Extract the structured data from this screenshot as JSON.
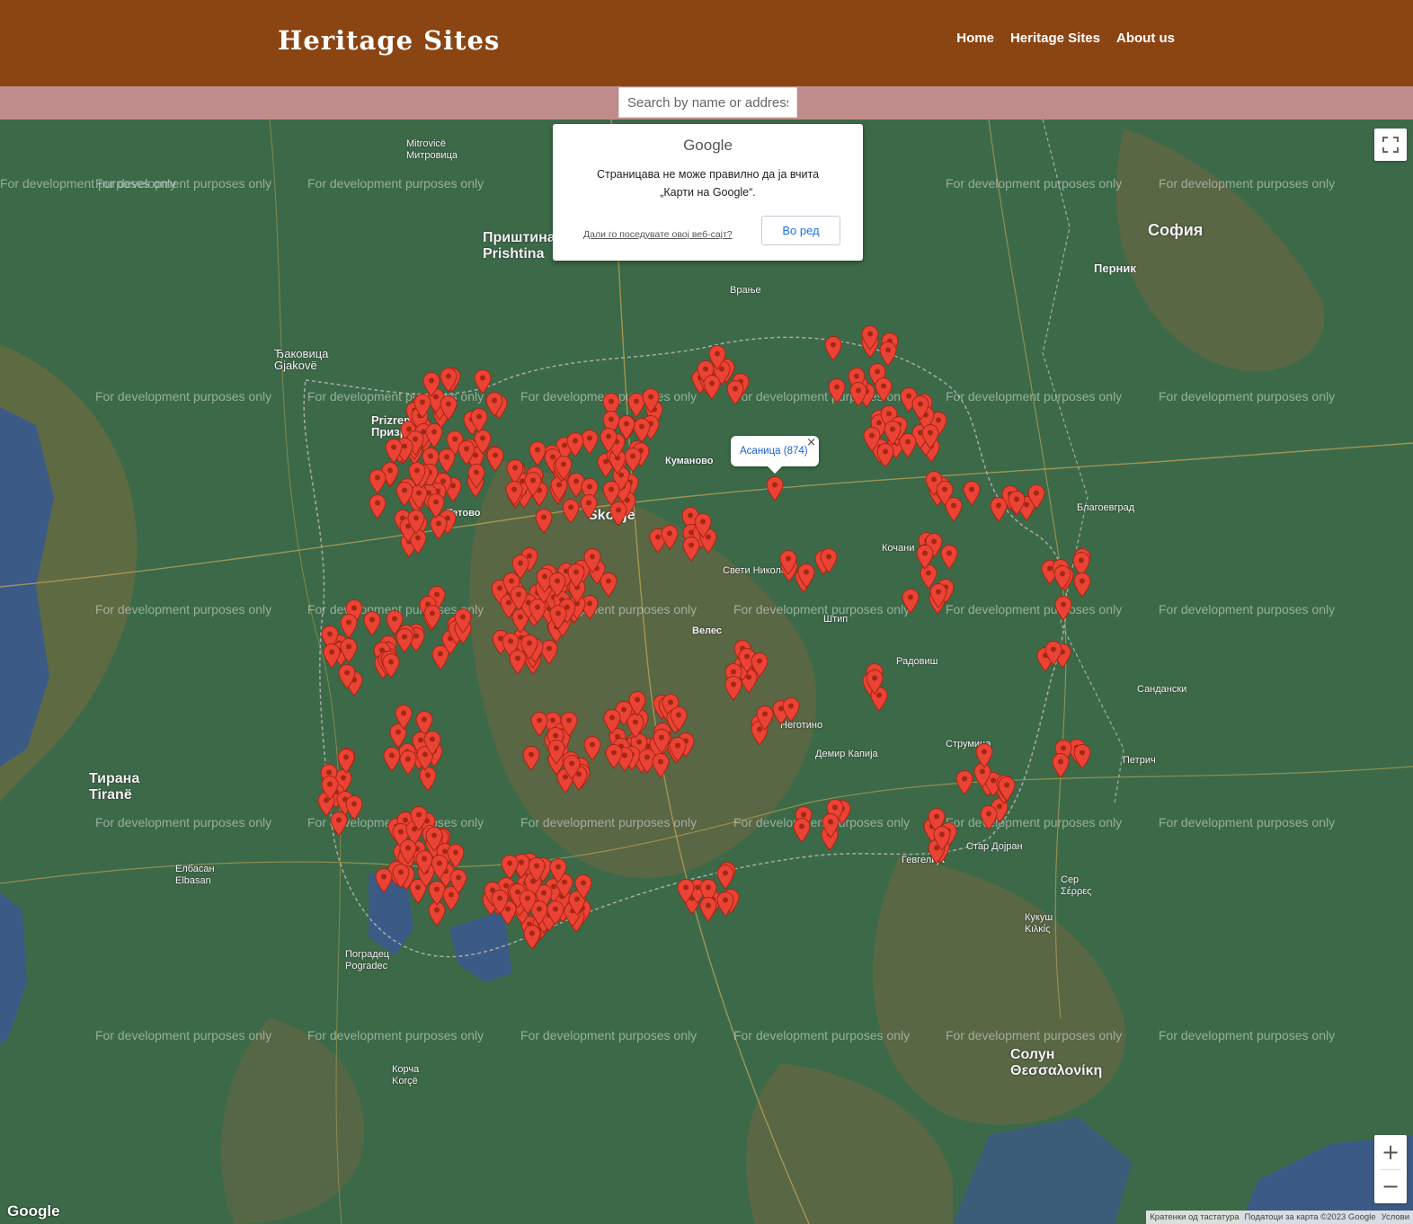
{
  "header": {
    "brand": "Heritage Sites",
    "nav": [
      "Home",
      "Heritage Sites",
      "About us"
    ]
  },
  "search": {
    "placeholder": "Search by name or address"
  },
  "map_dialog": {
    "logo": "Google",
    "message_line1": "Страницава не може правилно да ја вчита",
    "message_line2": "„Карти на Google“.",
    "link": "Дали го поседувате овој веб-сајт?",
    "ok_button": "Во ред"
  },
  "info_window": {
    "text": "Асаница (874)",
    "close": "×"
  },
  "watermark": "For development purposes only",
  "places": [
    {
      "text": "Mitrovicë\nМитровица"
    },
    {
      "text": "Приштина\nPrishtina"
    },
    {
      "text": "София"
    },
    {
      "text": "Перник"
    },
    {
      "text": "Ђаковица\nGjakovë"
    },
    {
      "text": "Prizren\nПризрен"
    },
    {
      "text": "Тетово"
    },
    {
      "text": "Skopje"
    },
    {
      "text": "Куманово"
    },
    {
      "text": "Велес"
    },
    {
      "text": "Свети Николе"
    },
    {
      "text": "Штип"
    },
    {
      "text": "Кочани"
    },
    {
      "text": "Радовиш"
    },
    {
      "text": "Струмица"
    },
    {
      "text": "Неготино"
    },
    {
      "text": "Демир Капија"
    },
    {
      "text": "Тирана\nTiranë"
    },
    {
      "text": "Елбасан\nElbasan"
    },
    {
      "text": "Поградец\nPogradec"
    },
    {
      "text": "Корча\nKorçë"
    },
    {
      "text": "Солун\nΘεσσαλονίκη"
    },
    {
      "text": "Кукуш\nΚιλκίς"
    },
    {
      "text": "Сер\nΣέρρες"
    },
    {
      "text": "Благоевград"
    },
    {
      "text": "Сандански"
    },
    {
      "text": "Петрич"
    },
    {
      "text": "Врање"
    },
    {
      "text": "Гевгелија"
    },
    {
      "text": "Стар Дојран"
    }
  ],
  "controls": {
    "zoom_in": "+",
    "zoom_out": "−"
  },
  "map_footer": {
    "google": "Google",
    "shortcuts": "Кратенки од тастатура",
    "data": "Податоци за карта ©2023 Google",
    "terms": "Услови"
  },
  "colors": {
    "header": "#8b4513",
    "search_band": "#c08b8b",
    "marker": "#ea4335",
    "map": "#3c6a48"
  }
}
